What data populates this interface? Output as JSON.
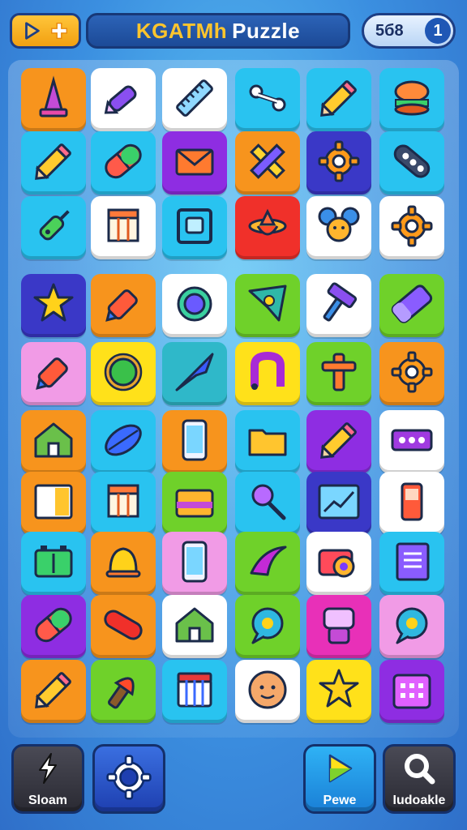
{
  "header": {
    "title_prefix": "KGATMh",
    "title_main": "Puzzle",
    "score": "5б8",
    "score_badge": "1",
    "left_icons": [
      "play-icon",
      "plus-icon"
    ]
  },
  "colors": {
    "orange": "#f7941d",
    "white": "#ffffff",
    "cyan": "#29c3f0",
    "purple": "#8e2de2",
    "indigo": "#3a38c7",
    "lime": "#6fd12a",
    "yellow": "#ffe11a",
    "red": "#f0302a",
    "pink": "#f19be6",
    "magenta": "#e830b8",
    "teal": "#2fb8c9"
  },
  "tiles": [
    {
      "bg": "orange",
      "icon": "cone-icon"
    },
    {
      "bg": "white",
      "icon": "crayon-icon"
    },
    {
      "bg": "white",
      "icon": "ruler-icon"
    },
    {
      "bg": "cyan",
      "icon": "bone-icon"
    },
    {
      "bg": "cyan",
      "icon": "pencil-icon"
    },
    {
      "bg": "cyan",
      "icon": "burger-face-icon"
    },
    {
      "bg": "cyan",
      "icon": "pencil-icon"
    },
    {
      "bg": "cyan",
      "icon": "capsule-icon"
    },
    {
      "bg": "purple",
      "icon": "envelope-icon"
    },
    {
      "bg": "orange",
      "icon": "crossed-pencils-icon"
    },
    {
      "bg": "indigo",
      "icon": "gear-icon"
    },
    {
      "bg": "cyan",
      "icon": "remote-icon"
    },
    {
      "bg": "cyan",
      "icon": "syringe-icon"
    },
    {
      "bg": "white",
      "icon": "box-icon"
    },
    {
      "bg": "cyan",
      "icon": "frame-icon"
    },
    {
      "bg": "red",
      "icon": "spinning-top-icon"
    },
    {
      "bg": "white",
      "icon": "mouse-face-icon"
    },
    {
      "bg": "white",
      "icon": "gear-icon"
    },
    {
      "bg": "indigo",
      "icon": "star-icon"
    },
    {
      "bg": "orange",
      "icon": "marker-icon"
    },
    {
      "bg": "white",
      "icon": "ring-icon"
    },
    {
      "bg": "lime",
      "icon": "diamond-icon"
    },
    {
      "bg": "white",
      "icon": "hammer-icon"
    },
    {
      "bg": "lime",
      "icon": "eraser-icon"
    },
    {
      "bg": "pink",
      "icon": "marker-icon"
    },
    {
      "bg": "yellow",
      "icon": "sun-gear-icon"
    },
    {
      "bg": "teal",
      "icon": "dart-icon"
    },
    {
      "bg": "yellow",
      "icon": "magnet-icon"
    },
    {
      "bg": "lime",
      "icon": "cross-icon"
    },
    {
      "bg": "orange",
      "icon": "gear-icon"
    },
    {
      "bg": "orange",
      "icon": "house-icon"
    },
    {
      "bg": "cyan",
      "icon": "leaf-icon"
    },
    {
      "bg": "orange",
      "icon": "phone-icon"
    },
    {
      "bg": "cyan",
      "icon": "folder-icon"
    },
    {
      "bg": "purple",
      "icon": "pencil-icon"
    },
    {
      "bg": "white",
      "icon": "domino-icon"
    },
    {
      "bg": "orange",
      "icon": "window-icon"
    },
    {
      "bg": "cyan",
      "icon": "box-icon"
    },
    {
      "bg": "lime",
      "icon": "wallet-icon"
    },
    {
      "bg": "cyan",
      "icon": "magnifier-icon"
    },
    {
      "bg": "indigo",
      "icon": "chart-icon"
    },
    {
      "bg": "white",
      "icon": "device-icon"
    },
    {
      "bg": "cyan",
      "icon": "battery-icon"
    },
    {
      "bg": "orange",
      "icon": "bell-icon"
    },
    {
      "bg": "pink",
      "icon": "phone-icon"
    },
    {
      "bg": "lime",
      "icon": "boomerang-icon"
    },
    {
      "bg": "white",
      "icon": "camera-icon"
    },
    {
      "bg": "cyan",
      "icon": "notebook-icon"
    },
    {
      "bg": "purple",
      "icon": "capsule-icon"
    },
    {
      "bg": "orange",
      "icon": "sausage-icon"
    },
    {
      "bg": "white",
      "icon": "house-icon"
    },
    {
      "bg": "lime",
      "icon": "chat-icon"
    },
    {
      "bg": "magenta",
      "icon": "robot-icon"
    },
    {
      "bg": "pink",
      "icon": "chat-icon"
    },
    {
      "bg": "orange",
      "icon": "pencil-icon"
    },
    {
      "bg": "lime",
      "icon": "torch-icon"
    },
    {
      "bg": "cyan",
      "icon": "basket-icon"
    },
    {
      "bg": "white",
      "icon": "face-icon"
    },
    {
      "bg": "yellow",
      "icon": "star-icon"
    },
    {
      "bg": "purple",
      "icon": "calendar-icon"
    }
  ],
  "footer": {
    "btn1": {
      "label": "Sloam",
      "icon": "bolt-icon"
    },
    "btn2": {
      "label": "",
      "icon": "settings-icon"
    },
    "btn3": {
      "label": "Pewe",
      "icon": "play-icon"
    },
    "btn4": {
      "label": "Iudoakle",
      "icon": "search-icon"
    }
  }
}
